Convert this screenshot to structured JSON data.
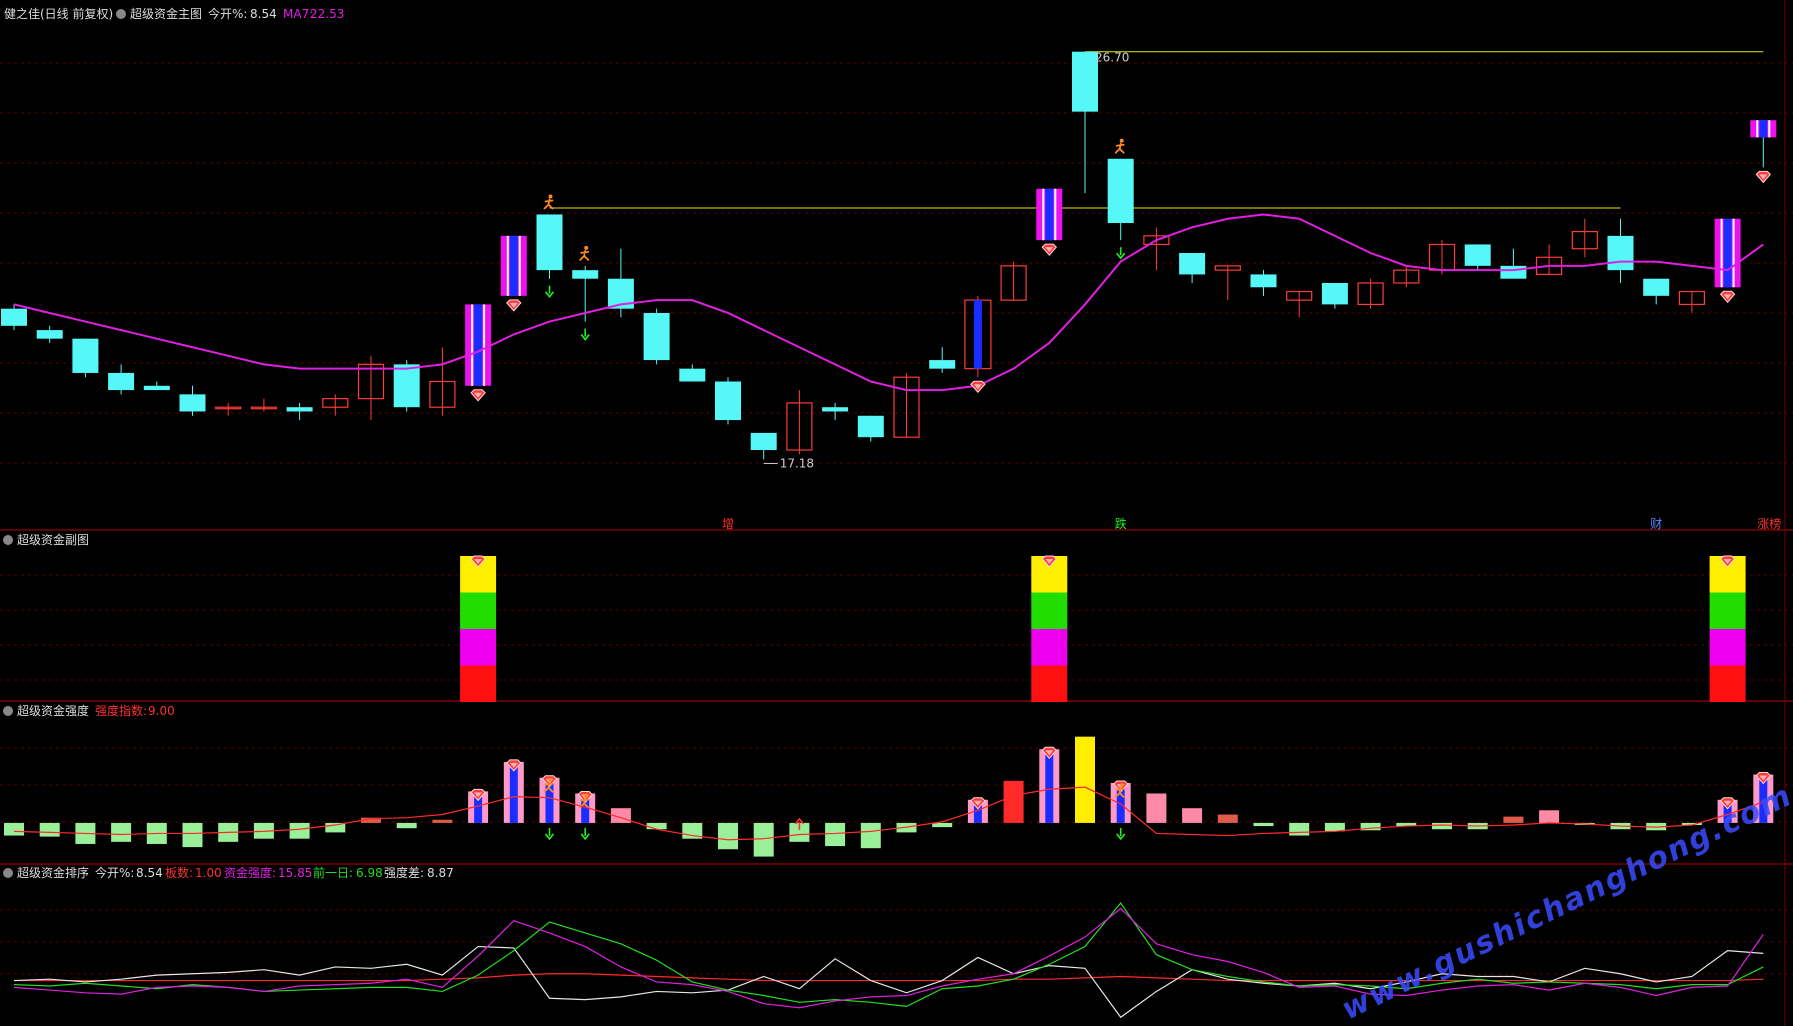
{
  "colors": {
    "background": "#000000",
    "grid": "#5a0000",
    "border": "#7a0000",
    "up_candle": "#ff3b3b",
    "down_candle": "#55f7f7",
    "ma_line": "#e020e0",
    "yellow_line": "#e8e800",
    "watermark": "#3a4cff",
    "strength_up": "#ff2a2a",
    "strength_down": "#99f099",
    "white_line": "#e6e6e6",
    "green_line": "#22dd22",
    "magenta_line": "#e020e0",
    "red_line": "#ff2a2a"
  },
  "header": {
    "stock": "健之佳(日线 前复权)",
    "indicator": "超级资金主图",
    "open_pct_label": "今开%:",
    "open_pct_value": "8.54",
    "ma_label": "MA7:",
    "ma_value": "22.53"
  },
  "sub_panel": {
    "title": "超级资金副图",
    "signal_bars": [
      {
        "x_index": 13,
        "colors": [
          "#ffee00",
          "#22dd00",
          "#ee00ee",
          "#ff1010"
        ]
      },
      {
        "x_index": 29,
        "colors": [
          "#ffee00",
          "#22dd00",
          "#ee00ee",
          "#ff1010"
        ]
      },
      {
        "x_index": 48,
        "colors": [
          "#ffee00",
          "#22dd00",
          "#ee00ee",
          "#ff1010"
        ]
      }
    ]
  },
  "strength_panel": {
    "title": "超级资金强度",
    "index_label": "强度指数:",
    "index_value": "9.00"
  },
  "rank_panel": {
    "title": "超级资金排序",
    "open_pct_label": "今开%:",
    "open_pct_value": "8.54",
    "board_label": "板数:",
    "board_value": "1.00",
    "strength_label": "资金强度:",
    "strength_value": "15.85",
    "prev_label": "前一日:",
    "prev_value": "6.98",
    "diff_label": "强度差:",
    "diff_value": "8.87"
  },
  "axis_events": [
    {
      "text": "增",
      "x_index": 20,
      "color": "#ff3030"
    },
    {
      "text": "跌",
      "x_index": 31,
      "color": "#22ee22"
    },
    {
      "text": "财",
      "x_index": 46,
      "color": "#5588ff"
    },
    {
      "text": "涨榜",
      "x_index": 49,
      "color": "#ff3030"
    }
  ],
  "chart_data": {
    "type": "candlestick",
    "price_range": [
      16.0,
      27.3
    ],
    "high_label": "26.70",
    "low_label": "17.18",
    "high_index": 30,
    "low_index": 21,
    "resistance_levels": [
      {
        "price": 26.7,
        "from_index": 30,
        "to_index": 49
      },
      {
        "price": 23.05,
        "from_index": 15,
        "to_index": 45
      }
    ],
    "candles": [
      {
        "o": 20.7,
        "h": 20.8,
        "l": 20.2,
        "c": 20.3
      },
      {
        "o": 20.2,
        "h": 20.3,
        "l": 19.9,
        "c": 20.0
      },
      {
        "o": 20.0,
        "h": 20.0,
        "l": 19.1,
        "c": 19.2
      },
      {
        "o": 19.2,
        "h": 19.4,
        "l": 18.7,
        "c": 18.8
      },
      {
        "o": 18.9,
        "h": 19.0,
        "l": 18.8,
        "c": 18.8
      },
      {
        "o": 18.7,
        "h": 18.9,
        "l": 18.2,
        "c": 18.3
      },
      {
        "o": 18.4,
        "h": 18.5,
        "l": 18.2,
        "c": 18.4
      },
      {
        "o": 18.4,
        "h": 18.6,
        "l": 18.3,
        "c": 18.4
      },
      {
        "o": 18.4,
        "h": 18.5,
        "l": 18.1,
        "c": 18.3
      },
      {
        "o": 18.4,
        "h": 18.7,
        "l": 18.2,
        "c": 18.6
      },
      {
        "o": 18.6,
        "h": 19.6,
        "l": 18.1,
        "c": 19.4
      },
      {
        "o": 19.4,
        "h": 19.5,
        "l": 18.3,
        "c": 18.4
      },
      {
        "o": 18.4,
        "h": 19.8,
        "l": 18.2,
        "c": 19.0
      },
      {
        "o": 18.9,
        "h": 20.8,
        "l": 18.9,
        "c": 20.8,
        "sig": 1
      },
      {
        "o": 21.0,
        "h": 22.4,
        "l": 21.0,
        "c": 22.4,
        "sig": 1
      },
      {
        "o": 22.9,
        "h": 22.9,
        "l": 21.4,
        "c": 21.6
      },
      {
        "o": 21.6,
        "h": 21.7,
        "l": 20.4,
        "c": 21.4
      },
      {
        "o": 21.4,
        "h": 22.1,
        "l": 20.5,
        "c": 20.7
      },
      {
        "o": 20.6,
        "h": 20.7,
        "l": 19.4,
        "c": 19.5
      },
      {
        "o": 19.3,
        "h": 19.4,
        "l": 19.0,
        "c": 19.0
      },
      {
        "o": 19.0,
        "h": 19.1,
        "l": 18.0,
        "c": 18.1
      },
      {
        "o": 17.8,
        "h": 17.8,
        "l": 17.18,
        "c": 17.4
      },
      {
        "o": 17.4,
        "h": 18.8,
        "l": 17.3,
        "c": 18.5
      },
      {
        "o": 18.4,
        "h": 18.5,
        "l": 18.1,
        "c": 18.3
      },
      {
        "o": 18.2,
        "h": 18.2,
        "l": 17.6,
        "c": 17.7
      },
      {
        "o": 17.7,
        "h": 19.2,
        "l": 17.7,
        "c": 19.1
      },
      {
        "o": 19.5,
        "h": 19.8,
        "l": 19.2,
        "c": 19.3
      },
      {
        "o": 19.3,
        "h": 21.0,
        "l": 19.1,
        "c": 20.9,
        "sig": 2
      },
      {
        "o": 20.9,
        "h": 21.8,
        "l": 20.9,
        "c": 21.7
      },
      {
        "o": 22.3,
        "h": 23.5,
        "l": 22.3,
        "c": 23.5,
        "sig": 1
      },
      {
        "o": 26.7,
        "h": 26.7,
        "l": 23.4,
        "c": 25.3
      },
      {
        "o": 24.2,
        "h": 24.2,
        "l": 22.3,
        "c": 22.7
      },
      {
        "o": 22.2,
        "h": 22.6,
        "l": 21.6,
        "c": 22.4
      },
      {
        "o": 22.0,
        "h": 22.0,
        "l": 21.3,
        "c": 21.5
      },
      {
        "o": 21.6,
        "h": 21.7,
        "l": 20.9,
        "c": 21.7
      },
      {
        "o": 21.5,
        "h": 21.6,
        "l": 21.0,
        "c": 21.2
      },
      {
        "o": 20.9,
        "h": 21.1,
        "l": 20.5,
        "c": 21.1
      },
      {
        "o": 21.3,
        "h": 21.3,
        "l": 20.7,
        "c": 20.8
      },
      {
        "o": 20.8,
        "h": 21.4,
        "l": 20.7,
        "c": 21.3
      },
      {
        "o": 21.3,
        "h": 21.7,
        "l": 21.2,
        "c": 21.6
      },
      {
        "o": 21.6,
        "h": 22.3,
        "l": 21.5,
        "c": 22.2
      },
      {
        "o": 22.2,
        "h": 22.2,
        "l": 21.6,
        "c": 21.7
      },
      {
        "o": 21.7,
        "h": 22.1,
        "l": 21.4,
        "c": 21.4
      },
      {
        "o": 21.5,
        "h": 22.2,
        "l": 21.5,
        "c": 21.9
      },
      {
        "o": 22.1,
        "h": 22.8,
        "l": 21.9,
        "c": 22.5
      },
      {
        "o": 22.4,
        "h": 22.8,
        "l": 21.3,
        "c": 21.6
      },
      {
        "o": 21.4,
        "h": 21.4,
        "l": 20.8,
        "c": 21.0
      },
      {
        "o": 20.8,
        "h": 21.1,
        "l": 20.6,
        "c": 21.1
      },
      {
        "o": 21.2,
        "h": 22.8,
        "l": 21.2,
        "c": 22.8,
        "sig": 1
      },
      {
        "o": 25.1,
        "h": 25.1,
        "l": 24.0,
        "c": 24.7,
        "sig": 1
      }
    ],
    "ma7": [
      20.8,
      20.6,
      20.4,
      20.2,
      20.0,
      19.8,
      19.6,
      19.4,
      19.3,
      19.3,
      19.3,
      19.3,
      19.4,
      19.7,
      20.1,
      20.4,
      20.6,
      20.8,
      20.9,
      20.9,
      20.6,
      20.2,
      19.8,
      19.4,
      19.0,
      18.8,
      18.8,
      18.9,
      19.3,
      19.9,
      20.8,
      21.8,
      22.3,
      22.6,
      22.8,
      22.9,
      22.8,
      22.4,
      22.0,
      21.7,
      21.6,
      21.6,
      21.6,
      21.7,
      21.7,
      21.8,
      21.8,
      21.7,
      21.6,
      22.2
    ],
    "markers": [
      {
        "i": 13,
        "type": "heart"
      },
      {
        "i": 14,
        "type": "heart"
      },
      {
        "i": 15,
        "type": "runner"
      },
      {
        "i": 15,
        "type": "down"
      },
      {
        "i": 16,
        "type": "runner"
      },
      {
        "i": 16,
        "type": "down"
      },
      {
        "i": 27,
        "type": "heart"
      },
      {
        "i": 29,
        "type": "heart"
      },
      {
        "i": 31,
        "type": "runner"
      },
      {
        "i": 31,
        "type": "down"
      },
      {
        "i": 48,
        "type": "heart"
      },
      {
        "i": 49,
        "type": "heart"
      }
    ],
    "strength_range": [
      -4,
      9.5
    ],
    "strength": [
      -1.2,
      -1.3,
      -2.0,
      -1.8,
      -2.0,
      -2.3,
      -1.8,
      -1.5,
      -1.5,
      -0.9,
      0.5,
      -0.5,
      0.3,
      3.0,
      5.8,
      4.3,
      2.8,
      1.4,
      -0.6,
      -1.5,
      -2.5,
      -3.2,
      -1.8,
      -2.2,
      -2.4,
      -0.9,
      -0.4,
      2.2,
      4.0,
      7.0,
      8.2,
      3.8,
      2.8,
      1.4,
      0.8,
      -0.3,
      -1.2,
      -0.8,
      -0.7,
      -0.3,
      -0.6,
      -0.6,
      0.6,
      1.2,
      -0.2,
      -0.6,
      -0.7,
      -0.2,
      2.2,
      4.6
    ],
    "strength_hatch": [
      13,
      14,
      15,
      16,
      27,
      29,
      31,
      48,
      49
    ],
    "strength_line": [
      -0.8,
      -0.9,
      -1.0,
      -1.1,
      -1.0,
      -1.0,
      -0.9,
      -0.8,
      -0.6,
      -0.2,
      0.4,
      0.5,
      0.8,
      1.6,
      2.5,
      2.4,
      1.5,
      0.5,
      -0.6,
      -1.2,
      -1.6,
      -1.5,
      -1.1,
      -1.0,
      -0.8,
      -0.4,
      0.1,
      1.2,
      2.6,
      3.2,
      3.4,
      1.8,
      -1.0,
      -1.1,
      -1.2,
      -1.0,
      -0.9,
      -0.8,
      -0.5,
      -0.3,
      -0.2,
      -0.3,
      -0.2,
      0.0,
      -0.1,
      -0.3,
      -0.4,
      -0.2,
      0.8,
      2.0
    ],
    "rank_range": [
      0,
      10
    ],
    "rank_white": [
      2.9,
      3.0,
      2.8,
      3.0,
      3.3,
      3.4,
      3.5,
      3.7,
      3.3,
      3.9,
      3.8,
      4.1,
      3.3,
      5.4,
      5.3,
      1.6,
      1.5,
      1.7,
      2.1,
      2.0,
      2.2,
      3.2,
      2.3,
      4.5,
      2.9,
      2.0,
      2.9,
      4.6,
      3.4,
      4.0,
      3.8,
      0.2,
      2.1,
      3.7,
      3.0,
      2.7,
      2.5,
      2.7,
      2.3,
      2.8,
      3.4,
      3.2,
      3.2,
      2.8,
      3.8,
      3.4,
      2.8,
      3.2,
      5.1,
      4.9
    ],
    "rank_magenta": [
      2.4,
      2.2,
      2.0,
      1.9,
      2.4,
      2.5,
      2.4,
      2.1,
      2.5,
      2.6,
      2.7,
      3.0,
      2.4,
      4.7,
      7.3,
      6.4,
      5.4,
      3.9,
      2.8,
      2.6,
      2.1,
      1.2,
      0.9,
      1.4,
      1.7,
      1.8,
      2.5,
      3.0,
      3.4,
      4.7,
      6.1,
      8.2,
      5.6,
      4.8,
      4.3,
      3.5,
      2.4,
      2.5,
      1.9,
      1.8,
      2.2,
      2.5,
      2.6,
      2.2,
      2.7,
      2.4,
      1.8,
      2.4,
      2.5,
      6.3
    ],
    "rank_green": [
      2.6,
      2.5,
      2.7,
      2.5,
      2.3,
      2.6,
      2.4,
      2.1,
      2.2,
      2.3,
      2.4,
      2.4,
      2.1,
      3.3,
      5.1,
      7.2,
      6.4,
      5.6,
      4.4,
      2.8,
      2.2,
      1.8,
      1.3,
      1.5,
      1.3,
      1.0,
      2.3,
      2.5,
      3.0,
      4.1,
      5.4,
      8.6,
      4.8,
      3.7,
      3.2,
      2.8,
      2.5,
      2.6,
      2.5,
      2.3,
      2.7,
      3.0,
      2.7,
      2.8,
      2.7,
      2.6,
      2.3,
      2.6,
      2.6,
      3.9
    ],
    "rank_red": [
      2.9,
      2.9,
      2.9,
      2.9,
      2.9,
      2.9,
      2.9,
      2.9,
      2.9,
      2.9,
      2.9,
      2.9,
      3.0,
      3.1,
      3.3,
      3.4,
      3.4,
      3.3,
      3.2,
      3.1,
      3.0,
      2.9,
      2.9,
      2.9,
      2.9,
      2.9,
      2.9,
      2.9,
      3.0,
      3.0,
      3.1,
      3.2,
      3.1,
      3.0,
      2.9,
      2.9,
      2.9,
      2.9,
      2.9,
      2.9,
      2.9,
      2.9,
      2.9,
      2.9,
      2.9,
      2.9,
      2.9,
      2.9,
      2.9,
      3.0
    ]
  },
  "watermark": "www.gushichanghong.com"
}
